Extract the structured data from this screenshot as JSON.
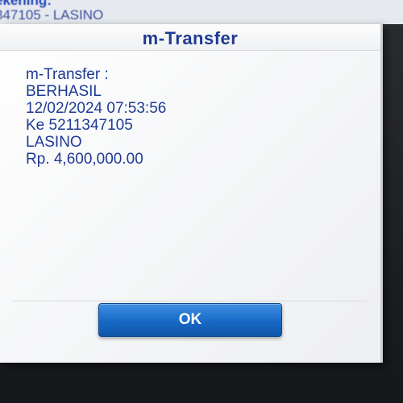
{
  "background": {
    "line1": "ekening:",
    "line2": "347105 - LASINO"
  },
  "dialog": {
    "title": "m-Transfer",
    "message_lines": [
      "m-Transfer :",
      "BERHASIL",
      "12/02/2024 07:53:56",
      "Ke 5211347105",
      "LASINO",
      "Rp. 4,600,000.00"
    ],
    "ok_label": "OK"
  },
  "colors": {
    "title_text": "#1f3a93",
    "button_blue": "#1769c6"
  }
}
